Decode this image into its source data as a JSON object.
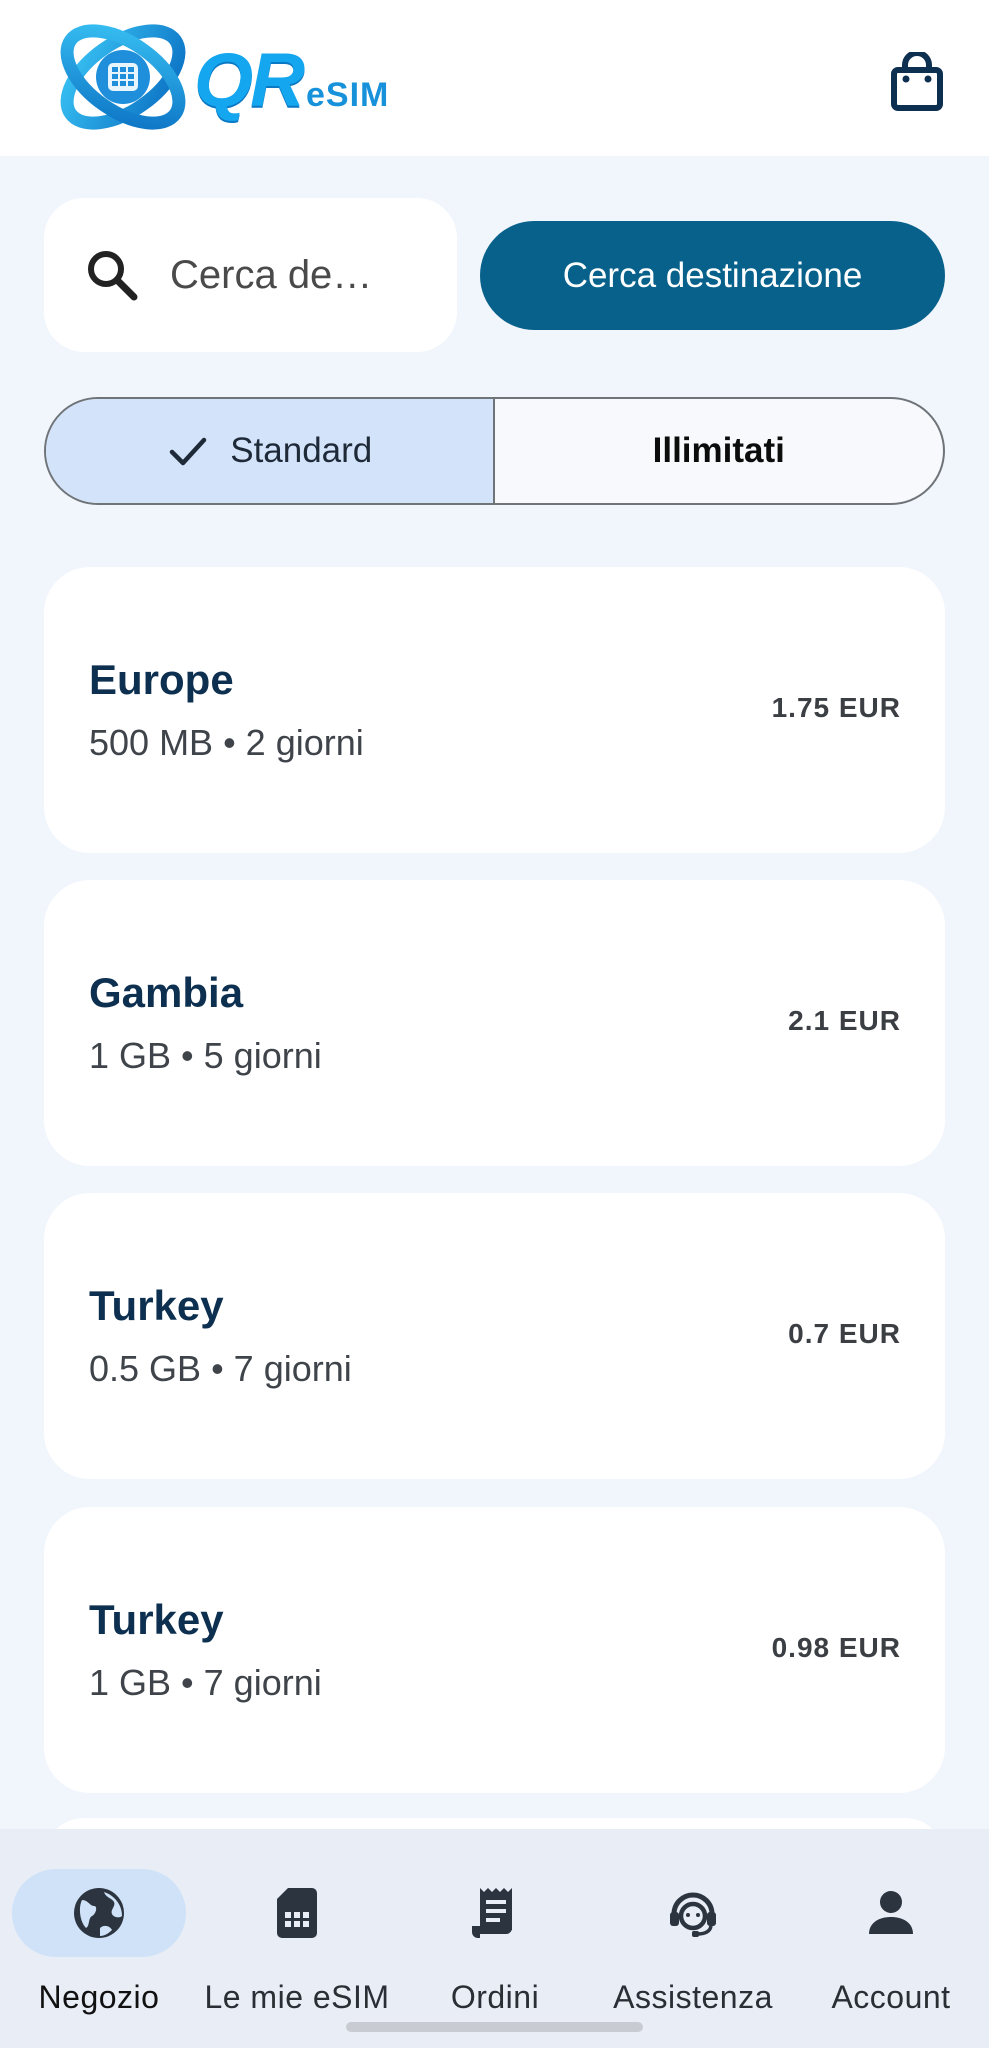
{
  "header": {
    "logo_primary": "QR",
    "logo_secondary": "eSIM",
    "cart_icon": "shopping-bag-icon"
  },
  "search": {
    "placeholder": "Cerca de…",
    "button_label": "Cerca destinazione"
  },
  "plan_type": {
    "options": [
      {
        "label": "Standard",
        "selected": true
      },
      {
        "label": "Illimitati",
        "selected": false
      }
    ]
  },
  "plans": [
    {
      "destination": "Europe",
      "details": "500 MB • 2 giorni",
      "price": "1.75 EUR"
    },
    {
      "destination": "Gambia",
      "details": "1 GB • 5 giorni",
      "price": "2.1 EUR"
    },
    {
      "destination": "Turkey",
      "details": "0.5 GB • 7 giorni",
      "price": "0.7 EUR"
    },
    {
      "destination": "Turkey",
      "details": "1 GB • 7 giorni",
      "price": "0.98 EUR"
    }
  ],
  "nav": {
    "items": [
      {
        "label": "Negozio",
        "icon": "globe-icon",
        "active": true
      },
      {
        "label": "Le mie eSIM",
        "icon": "sim-card-icon",
        "active": false
      },
      {
        "label": "Ordini",
        "icon": "receipt-icon",
        "active": false
      },
      {
        "label": "Assistenza",
        "icon": "support-agent-icon",
        "active": false
      },
      {
        "label": "Account",
        "icon": "person-icon",
        "active": false
      }
    ]
  },
  "colors": {
    "primary": "#07618a",
    "background": "#f1f5fc",
    "selected_segment": "#d3e3f9",
    "heading_text": "#0d2f50"
  }
}
